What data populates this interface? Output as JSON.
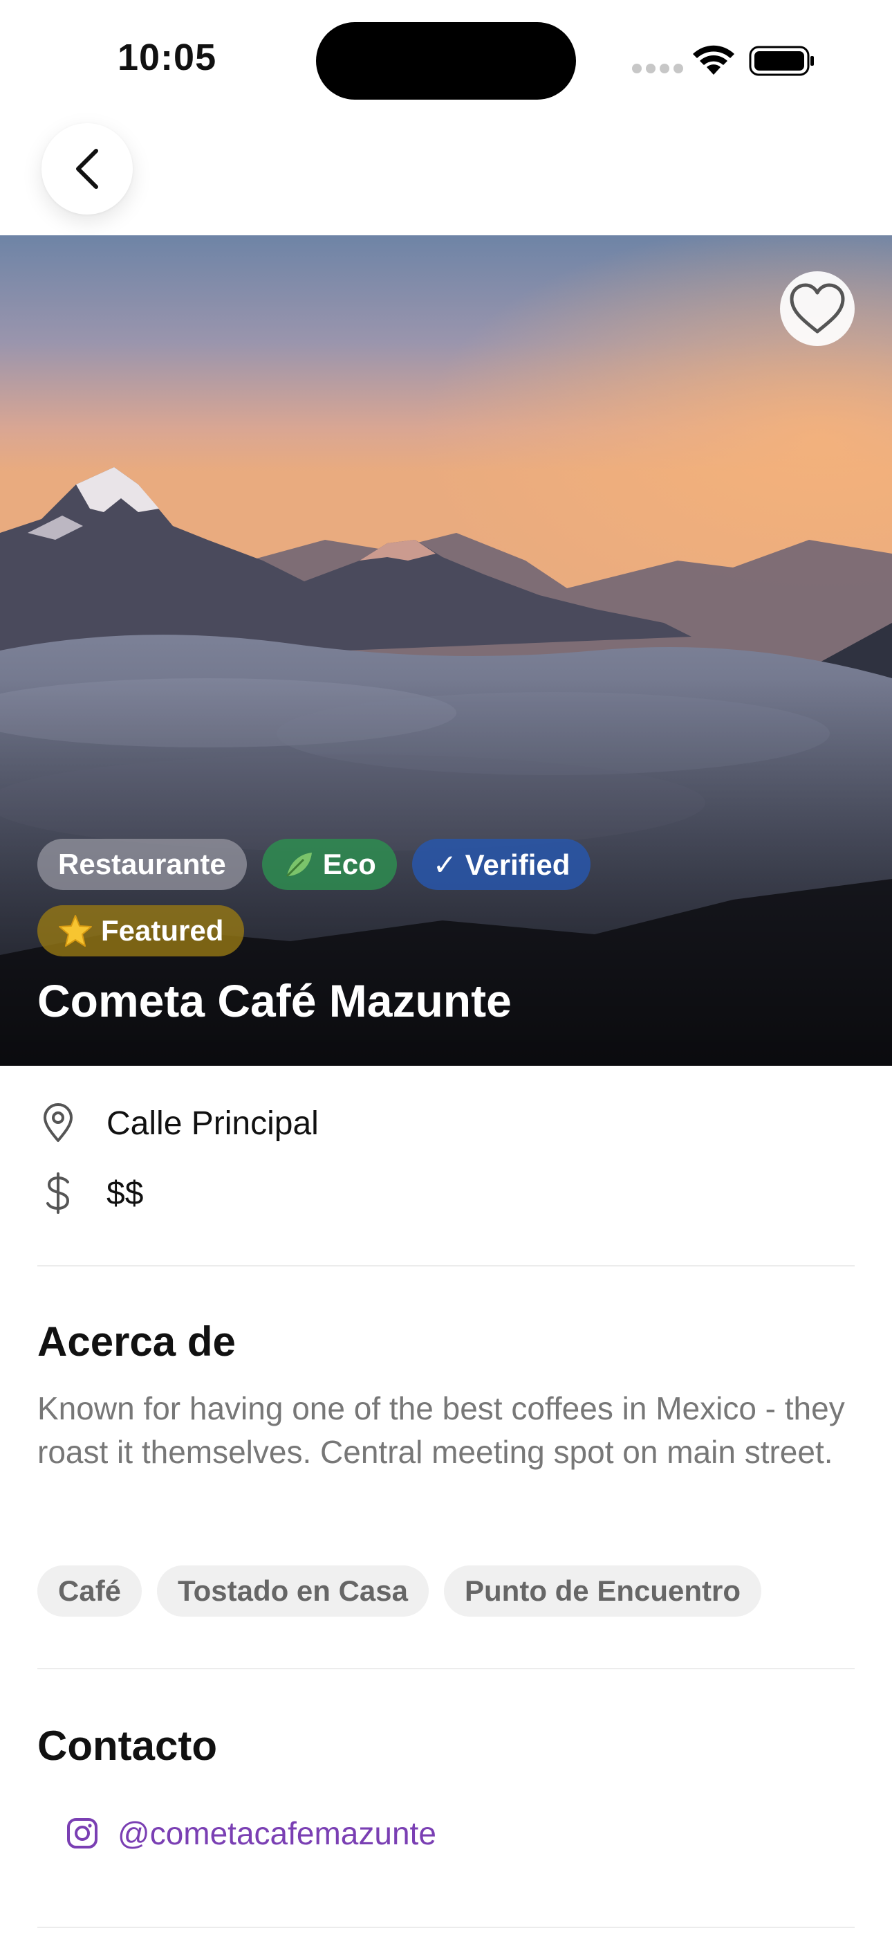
{
  "status_bar": {
    "time": "10:05"
  },
  "place": {
    "title": "Cometa Café Mazunte",
    "badges": {
      "category": "Restaurante",
      "eco": "Eco",
      "verified": "✓ Verified",
      "featured": "Featured"
    },
    "address": "Calle Principal",
    "price": "$$"
  },
  "about": {
    "title": "Acerca de",
    "text": "Known for having one of the best coffees in Mexico - they roast it themselves. Central meeting spot on main street.",
    "tags": [
      "Café",
      "Tostado en Casa",
      "Punto de Encuentro"
    ]
  },
  "contact": {
    "title": "Contacto",
    "instagram": "@cometacafemazunte"
  },
  "icons": {
    "back": "chevron-left-icon",
    "favorite": "heart-icon",
    "location": "map-pin-icon",
    "price": "dollar-icon",
    "instagram": "instagram-icon"
  },
  "colors": {
    "accent_purple": "#7a3fb3",
    "eco_green": "#2e8c50",
    "verified_blue": "#2856aa",
    "featured_gold": "#967814"
  }
}
